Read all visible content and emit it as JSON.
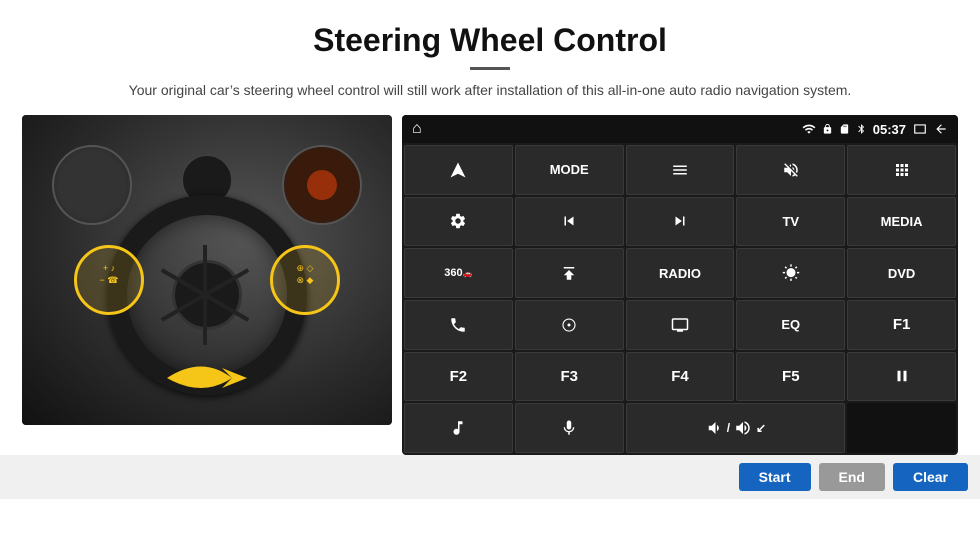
{
  "page": {
    "title": "Steering Wheel Control",
    "subtitle": "Your original car’s steering wheel control will still work after installation of this all-in-one auto radio navigation system."
  },
  "status_bar": {
    "wifi_icon": "wifi",
    "lock_icon": "lock",
    "card_icon": "sd",
    "bt_icon": "bt",
    "time": "05:37",
    "window_icon": "window",
    "back_icon": "back",
    "home_icon": "⌂"
  },
  "grid_buttons": [
    {
      "id": "r1c1",
      "type": "icon",
      "label": "⌂",
      "row": 1,
      "col": 1
    },
    {
      "id": "r1c2",
      "type": "icon",
      "label": "➤",
      "row": 1,
      "col": 2
    },
    {
      "id": "r1c3",
      "type": "text",
      "label": "MODE",
      "row": 1,
      "col": 3
    },
    {
      "id": "r1c4",
      "type": "icon",
      "label": "☰",
      "row": 1,
      "col": 4
    },
    {
      "id": "r1c5",
      "type": "icon",
      "label": "🔇",
      "row": 1,
      "col": 5
    },
    {
      "id": "r1c6",
      "type": "icon",
      "label": "⋮⋮",
      "row": 1,
      "col": 6
    },
    {
      "id": "r2c1",
      "type": "icon",
      "label": "⚙",
      "row": 2,
      "col": 1
    },
    {
      "id": "r2c2",
      "type": "icon",
      "label": "⏮",
      "row": 2,
      "col": 2
    },
    {
      "id": "r2c3",
      "type": "icon",
      "label": "⏭",
      "row": 2,
      "col": 3
    },
    {
      "id": "r2c4",
      "type": "text",
      "label": "TV",
      "row": 2,
      "col": 4
    },
    {
      "id": "r2c5",
      "type": "text",
      "label": "MEDIA",
      "row": 2,
      "col": 5
    },
    {
      "id": "r3c1",
      "type": "text",
      "label": "360",
      "row": 3,
      "col": 1
    },
    {
      "id": "r3c2",
      "type": "icon",
      "label": "⏶",
      "row": 3,
      "col": 2
    },
    {
      "id": "r3c3",
      "type": "text",
      "label": "RADIO",
      "row": 3,
      "col": 3
    },
    {
      "id": "r3c4",
      "type": "icon",
      "label": "☀",
      "row": 3,
      "col": 4
    },
    {
      "id": "r3c5",
      "type": "text",
      "label": "DVD",
      "row": 3,
      "col": 5
    },
    {
      "id": "r4c1",
      "type": "icon",
      "label": "📞",
      "row": 4,
      "col": 1
    },
    {
      "id": "r4c2",
      "type": "icon",
      "label": "⦿",
      "row": 4,
      "col": 2
    },
    {
      "id": "r4c3",
      "type": "icon",
      "label": "━",
      "row": 4,
      "col": 3
    },
    {
      "id": "r4c4",
      "type": "text",
      "label": "EQ",
      "row": 4,
      "col": 4
    },
    {
      "id": "r4c5",
      "type": "text",
      "label": "F1",
      "row": 4,
      "col": 5
    },
    {
      "id": "r5c1",
      "type": "text",
      "label": "F2",
      "row": 5,
      "col": 1
    },
    {
      "id": "r5c2",
      "type": "text",
      "label": "F3",
      "row": 5,
      "col": 2
    },
    {
      "id": "r5c3",
      "type": "text",
      "label": "F4",
      "row": 5,
      "col": 3
    },
    {
      "id": "r5c4",
      "type": "text",
      "label": "F5",
      "row": 5,
      "col": 4
    },
    {
      "id": "r5c5",
      "type": "icon",
      "label": "⏯",
      "row": 5,
      "col": 5
    },
    {
      "id": "r6c1",
      "type": "icon",
      "label": "♪",
      "row": 6,
      "col": 1
    },
    {
      "id": "r6c2",
      "type": "icon",
      "label": "🎤",
      "row": 6,
      "col": 2
    },
    {
      "id": "r6c3",
      "type": "icon",
      "label": "🔈↘",
      "span": 2,
      "row": 6,
      "col": 3
    }
  ],
  "actions": {
    "start_label": "Start",
    "end_label": "End",
    "clear_label": "Clear"
  }
}
